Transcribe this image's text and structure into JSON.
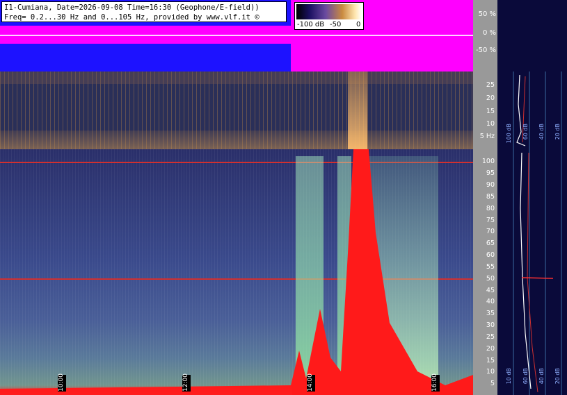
{
  "header": {
    "line1": "I1-Cumiana, Date=2026-09-08 Time=16:30 (Geophone/E-field))",
    "line2": "Freq= 0.2...30 Hz and 0...105 Hz, provided by www.vlf.it ©"
  },
  "legend": {
    "labels": [
      "-100 dB",
      "-50",
      "0"
    ]
  },
  "waveform_axis": [
    "50 %",
    "0 %",
    "-50 %"
  ],
  "lowfreq_axis": [
    "25",
    "20",
    "15",
    "10",
    "5 Hz"
  ],
  "main_axis": [
    "100",
    "95",
    "90",
    "85",
    "80",
    "75",
    "70",
    "65",
    "60",
    "55",
    "50",
    "45",
    "40",
    "35",
    "30",
    "25",
    "20",
    "15",
    "10",
    "5"
  ],
  "time_labels": [
    "10:00",
    "12:00",
    "14:00",
    "16:00"
  ],
  "right_panel": {
    "upper_labels": [
      "100 dB",
      "60 dB",
      "40 dB",
      "20 dB"
    ],
    "lower_labels": [
      "10 dB",
      "60 dB",
      "40 dB",
      "20 dB"
    ]
  },
  "colors": {
    "waveform_bg": "#1d12ff",
    "waveform_highlight": "#ff00ff",
    "saturation": "#ff1a1a",
    "panel_bg": "#0a0a3a",
    "axis_bg": "#999999"
  }
}
